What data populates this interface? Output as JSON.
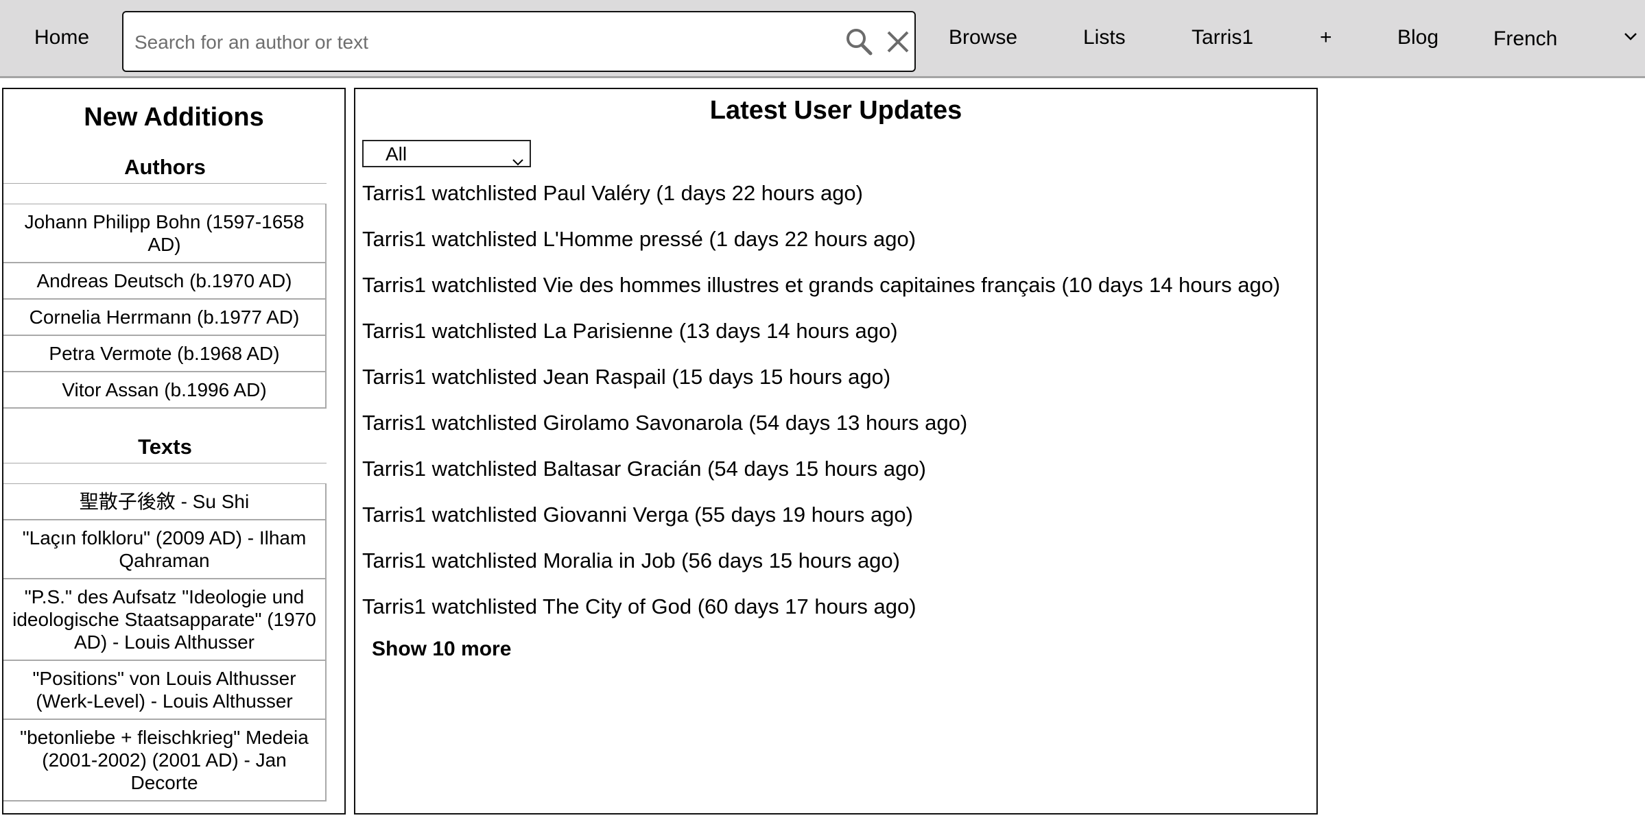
{
  "nav": {
    "home": "Home",
    "search_placeholder": "Search for an author or text",
    "browse": "Browse",
    "lists": "Lists",
    "user": "Tarris1",
    "add": "+",
    "blog": "Blog",
    "language": "French",
    "icons": [
      "search-icon",
      "close-icon",
      "chevron-down-icon"
    ]
  },
  "new_additions": {
    "title": "New Additions",
    "authors_heading": "Authors",
    "authors": [
      "Johann Philipp Bohn (1597-1658 AD)",
      "Andreas Deutsch (b.1970 AD)",
      "Cornelia Herrmann (b.1977 AD)",
      "Petra Vermote (b.1968 AD)",
      "Vitor Assan (b.1996 AD)"
    ],
    "texts_heading": "Texts",
    "texts": [
      "聖散子後敘 - Su Shi",
      "\"Laçın folkloru\" (2009 AD) - Ilham Qahraman",
      "\"P.S.\" des Aufsatz \"Ideologie und ideologische Staatsapparate\" (1970 AD) - Louis Althusser",
      "\"Positions\" von Louis Althusser (Werk-Level) - Louis Althusser",
      "\"betonliebe + fleischkrieg\" Medeia (2001-2002) (2001 AD) - Jan Decorte"
    ]
  },
  "updates": {
    "title": "Latest User Updates",
    "filter_value": "All",
    "items": [
      "Tarris1 watchlisted Paul Valéry (1 days 22 hours ago)",
      "Tarris1 watchlisted L'Homme pressé (1 days 22 hours ago)",
      "Tarris1 watchlisted Vie des hommes illustres et grands capitaines français (10 days 14 hours ago)",
      "Tarris1 watchlisted La Parisienne (13 days 14 hours ago)",
      "Tarris1 watchlisted Jean Raspail (15 days 15 hours ago)",
      "Tarris1 watchlisted Girolamo Savonarola (54 days 13 hours ago)",
      "Tarris1 watchlisted Baltasar Gracián (54 days 15 hours ago)",
      "Tarris1 watchlisted Giovanni Verga (55 days 19 hours ago)",
      "Tarris1 watchlisted Moralia in Job (56 days 15 hours ago)",
      "Tarris1 watchlisted The City of God (60 days 17 hours ago)"
    ],
    "show_more": "Show 10 more"
  }
}
